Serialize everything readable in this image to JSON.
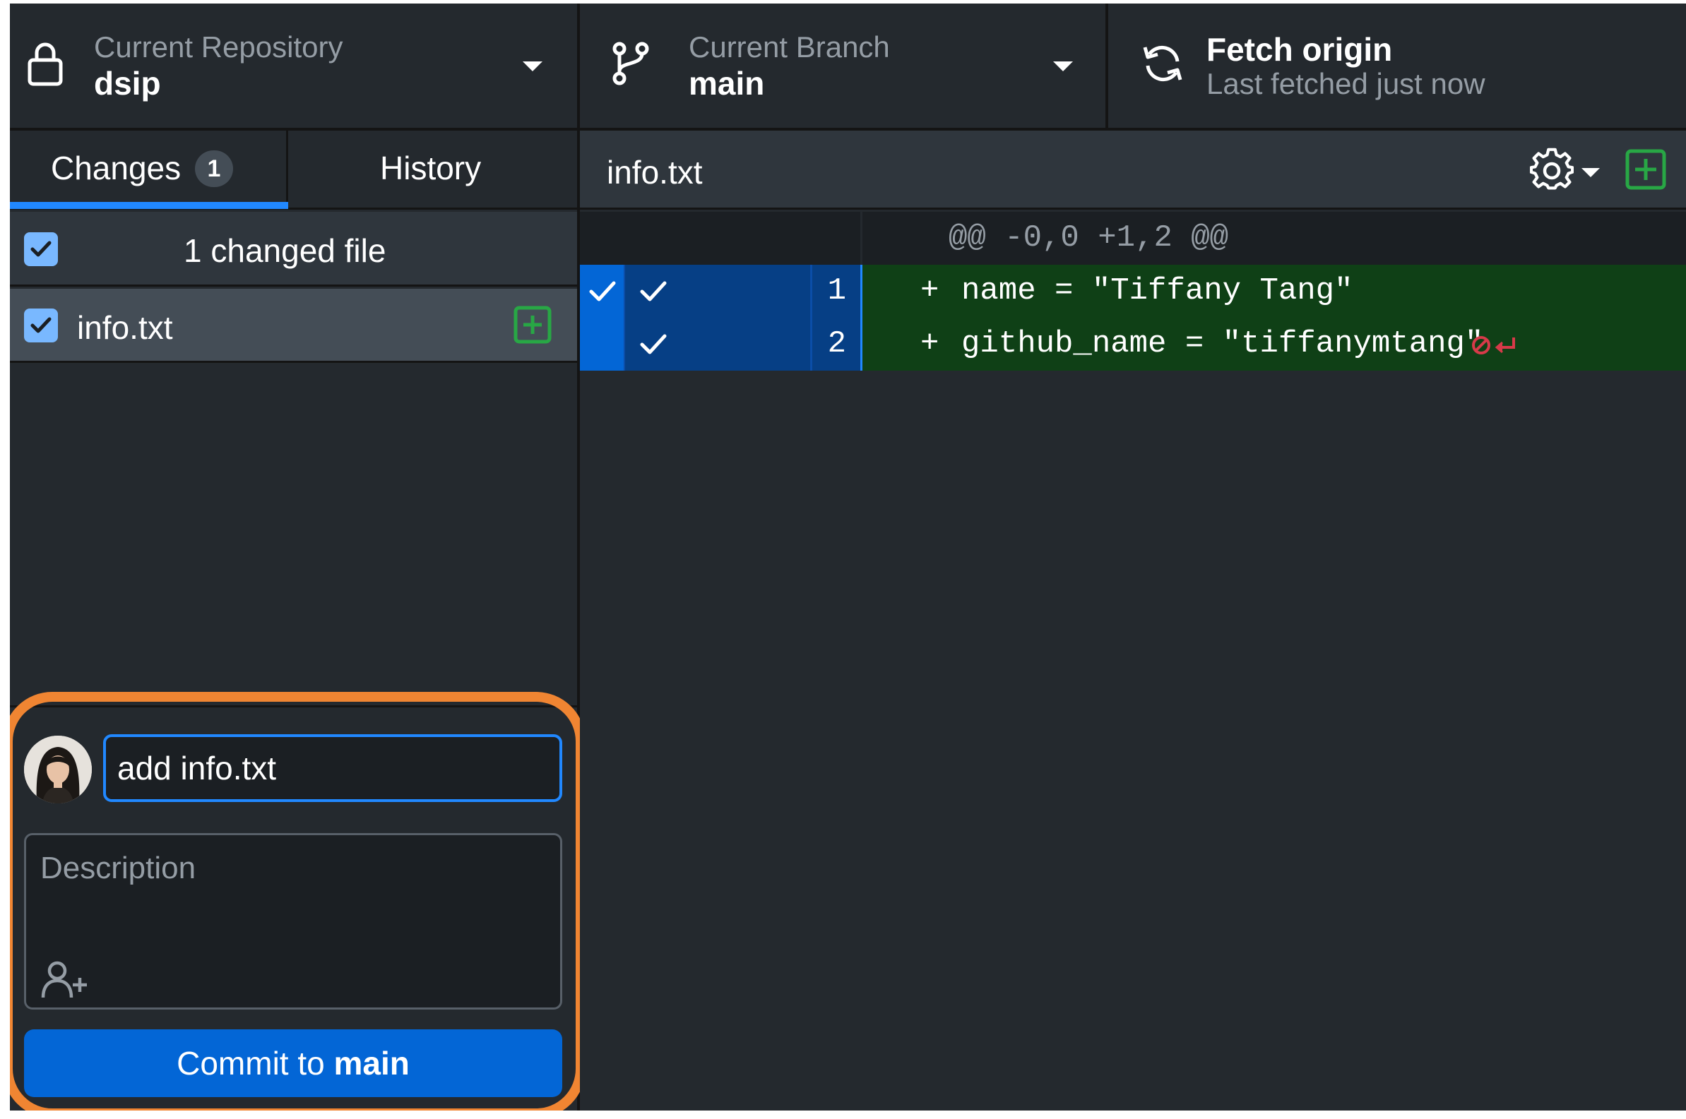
{
  "toolbar": {
    "repository": {
      "label": "Current Repository",
      "value": "dsip"
    },
    "branch": {
      "label": "Current Branch",
      "value": "main"
    },
    "fetch": {
      "title": "Fetch origin",
      "subtitle": "Last fetched just now"
    }
  },
  "sidebar": {
    "tabs": [
      {
        "label": "Changes",
        "badge": "1",
        "selected": true
      },
      {
        "label": "History",
        "selected": false
      }
    ],
    "changes_header": "1 changed file",
    "files": [
      {
        "name": "info.txt",
        "status_icon": "file-added-icon",
        "checked": true
      }
    ]
  },
  "commit": {
    "summary_value": "add info.txt",
    "description_placeholder": "Description",
    "button_prefix": "Commit to ",
    "button_branch": "main"
  },
  "diff": {
    "filename": "info.txt",
    "hunk_header": "@@ -0,0 +1,2 @@",
    "lines": [
      {
        "number": "1",
        "marker": "+",
        "text": "name = \"Tiffany Tang\""
      },
      {
        "number": "2",
        "marker": "+",
        "text": "github_name = \"tiffanymtang\""
      }
    ]
  },
  "colors": {
    "background": "#24292e",
    "accent": "#0366d6",
    "added_line": "#0f4016",
    "added_icon": "#28a745",
    "highlight": "#f08532"
  }
}
